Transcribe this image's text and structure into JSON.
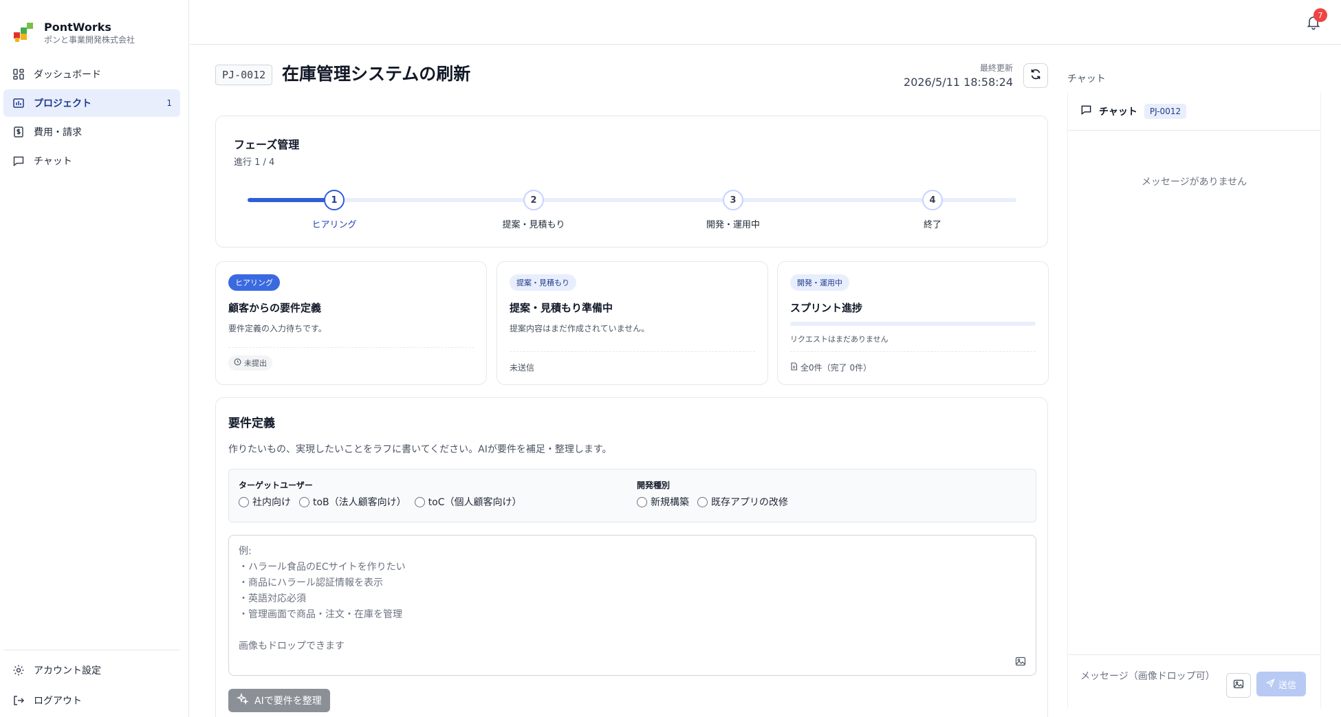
{
  "brand": {
    "name": "PontWorks",
    "subtitle": "ポンと事業開発株式会社"
  },
  "sidebar": {
    "items": [
      {
        "label": "ダッシュボード",
        "icon": "dashboard-icon"
      },
      {
        "label": "プロジェクト",
        "icon": "project-icon",
        "count": "1",
        "active": true
      },
      {
        "label": "費用・請求",
        "icon": "billing-icon"
      },
      {
        "label": "チャット",
        "icon": "chat-icon"
      }
    ],
    "bottom": [
      {
        "label": "アカウント設定",
        "icon": "gear-icon"
      },
      {
        "label": "ログアウト",
        "icon": "logout-icon"
      }
    ]
  },
  "topbar": {
    "notification_count": "7"
  },
  "project": {
    "code": "PJ-0012",
    "title": "在庫管理システムの刷新",
    "updated_label": "最終更新",
    "updated_value": "2026/5/11 18:58:24"
  },
  "phase": {
    "title": "フェーズ管理",
    "progress": "進行 1 / 4",
    "progress_fraction": 0.25,
    "steps": [
      {
        "num": "1",
        "label": "ヒアリング",
        "active": true
      },
      {
        "num": "2",
        "label": "提案・見積もり"
      },
      {
        "num": "3",
        "label": "開発・運用中"
      },
      {
        "num": "4",
        "label": "終了"
      }
    ]
  },
  "status_cards": [
    {
      "pill": "ヒアリング",
      "title": "顧客からの要件定義",
      "desc": "要件定義の入力待ちです。",
      "footer": "未提出"
    },
    {
      "pill": "提案・見積もり",
      "title": "提案・見積もり準備中",
      "desc": "提案内容はまだ作成されていません。",
      "footer": "未送信"
    },
    {
      "pill": "開発・運用中",
      "title": "スプリント進捗",
      "desc": "リクエストはまだありません",
      "footer": "全0件（完了 0件）",
      "progress_fraction": 0
    }
  ],
  "requirements": {
    "title": "要件定義",
    "description": "作りたいもの、実現したいことをラフに書いてください。AIが要件を補足・整理します。",
    "target_user": {
      "label": "ターゲットユーザー",
      "options": [
        "社内向け",
        "toB（法人顧客向け）",
        "toC（個人顧客向け）"
      ]
    },
    "dev_type": {
      "label": "開発種別",
      "options": [
        "新規構築",
        "既存アプリの改修"
      ]
    },
    "placeholder_lines": [
      "例:",
      "・ハラール食品のECサイトを作りたい",
      "・商品にハラール認証情報を表示",
      "・英語対応必須",
      "・管理画面で商品・注文・在庫を管理",
      "",
      "画像もドロップできます"
    ],
    "ai_button": "AIで要件を整理"
  },
  "chat": {
    "heading": "チャット",
    "panel_label": "チャット",
    "project_chip": "PJ-0012",
    "empty": "メッセージがありません",
    "input_placeholder": "メッセージ（画像ドロップ可）",
    "send_label": "送信"
  },
  "colors": {
    "accent": "#2f5fd6",
    "accent_soft": "#e8eefc",
    "badge": "#ef4444"
  }
}
